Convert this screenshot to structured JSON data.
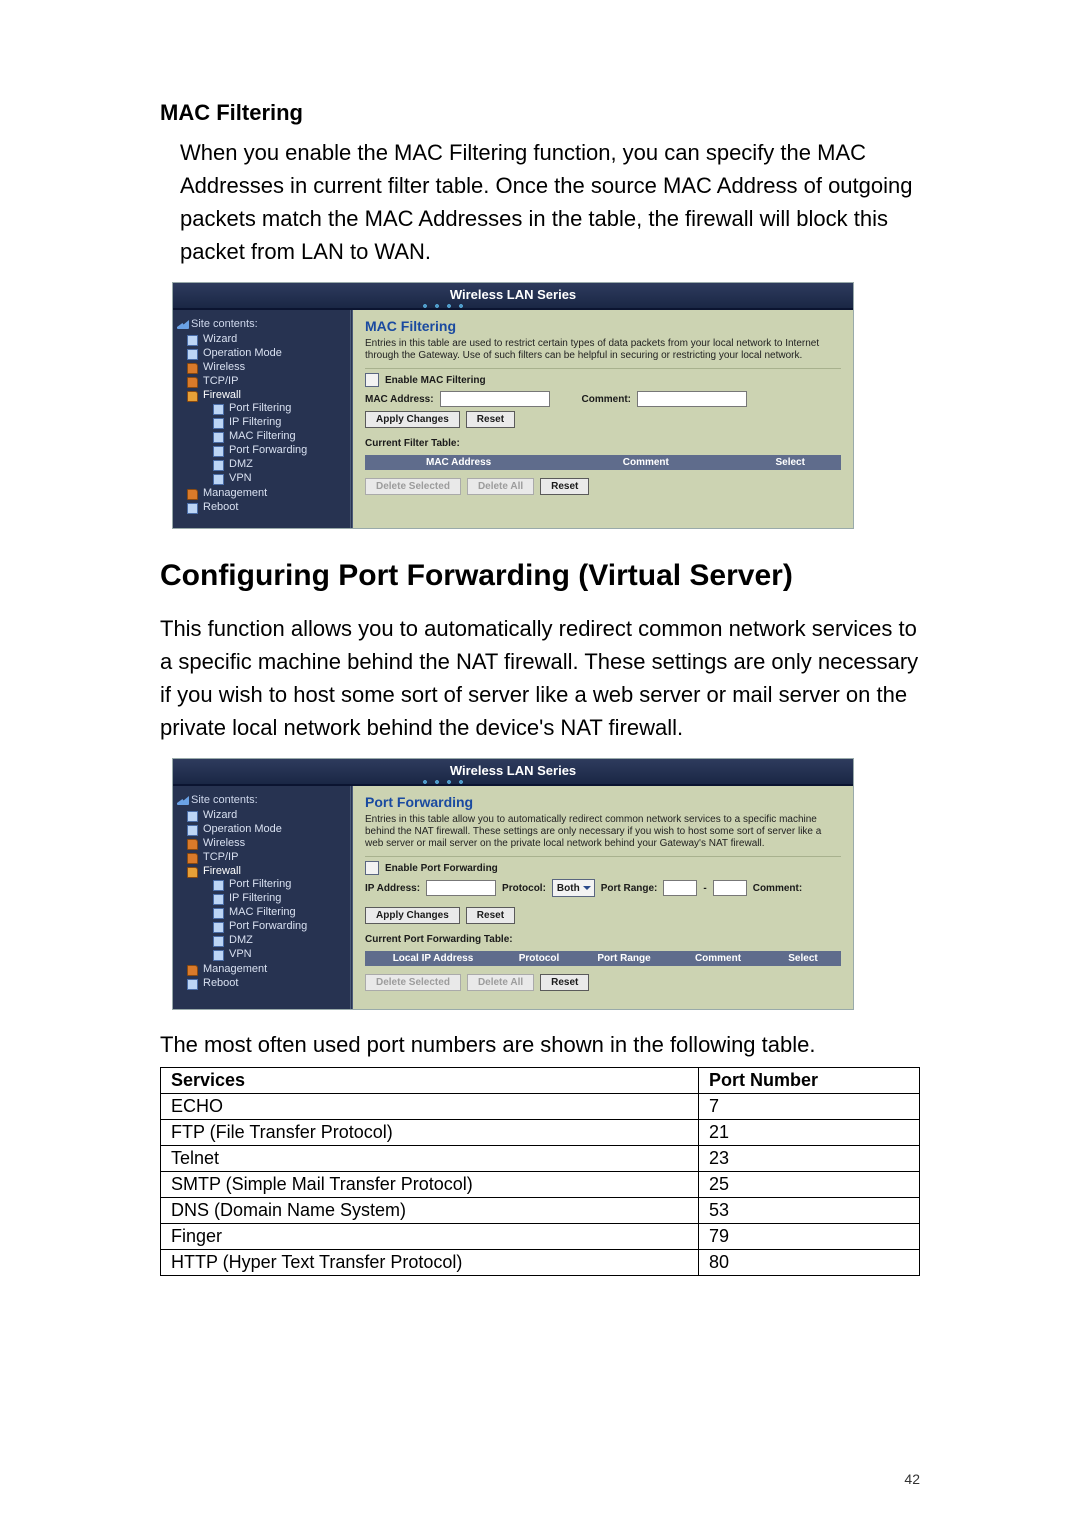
{
  "section1": {
    "heading": "MAC Filtering",
    "paragraph": "When you enable the MAC Filtering function, you can specify the MAC Addresses in current filter table. Once the source MAC Address of outgoing packets match the MAC Addresses in the table, the firewall will block this packet from LAN to WAN."
  },
  "router_banner": "Wireless LAN Series",
  "sidebar": {
    "title": "Site contents:",
    "items": [
      {
        "label": "Wizard",
        "icon": "doc"
      },
      {
        "label": "Operation Mode",
        "icon": "doc"
      },
      {
        "label": "Wireless",
        "icon": "folder"
      },
      {
        "label": "TCP/IP",
        "icon": "folder"
      },
      {
        "label": "Firewall",
        "icon": "folder-open",
        "children": [
          {
            "label": "Port Filtering",
            "icon": "doc"
          },
          {
            "label": "IP Filtering",
            "icon": "doc"
          },
          {
            "label": "MAC Filtering",
            "icon": "doc"
          },
          {
            "label": "Port Forwarding",
            "icon": "doc"
          },
          {
            "label": "DMZ",
            "icon": "doc"
          },
          {
            "label": "VPN",
            "icon": "doc"
          }
        ]
      },
      {
        "label": "Management",
        "icon": "folder"
      },
      {
        "label": "Reboot",
        "icon": "doc"
      }
    ]
  },
  "mac_screen": {
    "title": "MAC Filtering",
    "desc": "Entries in this table are used to restrict certain types of data packets from your local network to Internet through the Gateway. Use of such filters can be helpful in securing or restricting your local network.",
    "enable_label": "Enable MAC Filtering",
    "mac_label": "MAC Address:",
    "comment_label": "Comment:",
    "apply": "Apply Changes",
    "reset": "Reset",
    "table_label": "Current Filter Table:",
    "th_mac": "MAC Address",
    "th_comment": "Comment",
    "th_select": "Select",
    "del_sel": "Delete Selected",
    "del_all": "Delete All",
    "reset2": "Reset"
  },
  "section2": {
    "heading": "Configuring Port Forwarding (Virtual Server)",
    "paragraph": "This function allows you to automatically redirect common network services to a specific machine behind the NAT firewall. These settings are only necessary if you wish to host some sort of server like a web server or mail server on the private local network behind the device's NAT firewall."
  },
  "pf_screen": {
    "title": "Port Forwarding",
    "desc": "Entries in this table allow you to automatically redirect common network services to a specific machine behind the NAT firewall. These settings are only necessary if you wish to host some sort of server like a web server or mail server on the private local network behind your Gateway's NAT firewall.",
    "enable_label": "Enable Port Forwarding",
    "ip_label": "IP Address:",
    "proto_label": "Protocol:",
    "proto_value": "Both",
    "range_label": "Port Range:",
    "comment_label": "Comment:",
    "apply": "Apply Changes",
    "reset": "Reset",
    "table_label": "Current Port Forwarding Table:",
    "th_ip": "Local IP Address",
    "th_proto": "Protocol",
    "th_range": "Port Range",
    "th_comment": "Comment",
    "th_select": "Select",
    "del_sel": "Delete Selected",
    "del_all": "Delete All",
    "reset2": "Reset"
  },
  "footnote": "The most often used port numbers are shown in the following table.",
  "port_table": {
    "th_service": "Services",
    "th_port": "Port Number",
    "rows": [
      {
        "service": "ECHO",
        "port": "7"
      },
      {
        "service": "FTP (File Transfer Protocol)",
        "port": "21"
      },
      {
        "service": "Telnet",
        "port": "23"
      },
      {
        "service": "SMTP (Simple Mail Transfer Protocol)",
        "port": "25"
      },
      {
        "service": "DNS (Domain Name System)",
        "port": "53"
      },
      {
        "service": "Finger",
        "port": "79"
      },
      {
        "service": "HTTP (Hyper Text Transfer Protocol)",
        "port": "80"
      }
    ]
  },
  "page_number": "42",
  "chart_data": {
    "type": "table",
    "title": "Common service port numbers",
    "columns": [
      "Services",
      "Port Number"
    ],
    "rows": [
      [
        "ECHO",
        7
      ],
      [
        "FTP (File Transfer Protocol)",
        21
      ],
      [
        "Telnet",
        23
      ],
      [
        "SMTP (Simple Mail Transfer Protocol)",
        25
      ],
      [
        "DNS (Domain Name System)",
        53
      ],
      [
        "Finger",
        79
      ],
      [
        "HTTP (Hyper Text Transfer Protocol)",
        80
      ]
    ]
  }
}
